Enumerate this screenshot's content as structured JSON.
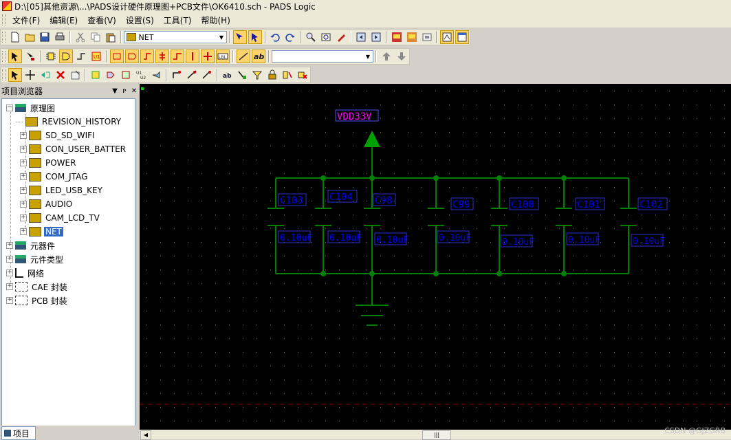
{
  "window": {
    "title": "D:\\[05]其他资源\\...\\PADS设计硬件原理图+PCB文件\\OK6410.sch - PADS Logic"
  },
  "menu": [
    "文件(F)",
    "编辑(E)",
    "查看(V)",
    "设置(S)",
    "工具(T)",
    "帮助(H)"
  ],
  "toolbar": {
    "net_combo": "NET",
    "text_combo": ""
  },
  "sidebar": {
    "title": "项目浏览器",
    "root": "原理图",
    "sheets": [
      "REVISION_HISTORY",
      "SD_SD_WIFI",
      "CON_USER_BATTER",
      "POWER",
      "COM_JTAG",
      "LED_USB_KEY",
      "AUDIO",
      "CAM_LCD_TV",
      "NET"
    ],
    "selected": "NET",
    "groups": [
      "元器件",
      "元件类型",
      "网络",
      "CAE 封装",
      "PCB 封装"
    ],
    "bottom_tab": "项目"
  },
  "schematic": {
    "power_net": "VDD33V",
    "capacitors": [
      {
        "ref": "C103",
        "value": "0.10uF"
      },
      {
        "ref": "C104",
        "value": "0.10uF"
      },
      {
        "ref": "C98",
        "value": "0.10uF"
      },
      {
        "ref": "C99",
        "value": "0.10uF"
      },
      {
        "ref": "C100",
        "value": "0.10uF"
      },
      {
        "ref": "C101",
        "value": "0.10uF"
      },
      {
        "ref": "C102",
        "value": "0.10uF"
      }
    ]
  },
  "watermark": "CSDN @GJZGRB",
  "colors": {
    "canvas": "#000000",
    "wire": "#008000",
    "power": "#00a000",
    "ref_text": "#0000ff",
    "net_text": "#ff00ff"
  }
}
